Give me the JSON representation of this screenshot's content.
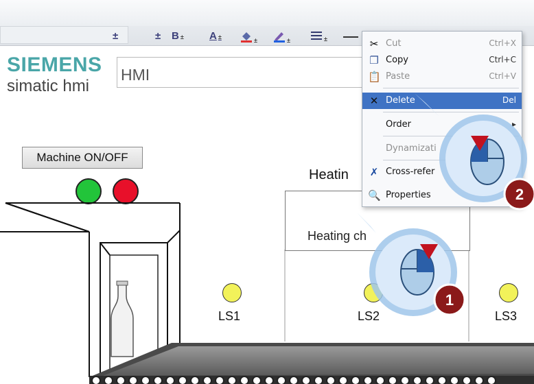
{
  "toolbar": {
    "bold": "B",
    "font_color": "A",
    "drop": "±"
  },
  "logo": {
    "brand": "SIEMENS",
    "product": "simatic hmi"
  },
  "screen_title": "HMI",
  "machine_button": "Machine ON/OFF",
  "heating": {
    "heading": "Heatin",
    "label": "Heating ch"
  },
  "sensors": [
    "LS1",
    "LS2",
    "LS3"
  ],
  "context_menu": {
    "items": [
      {
        "label": "Cut",
        "shortcut": "Ctrl+X",
        "icon": "scissors-icon",
        "enabled": false
      },
      {
        "label": "Copy",
        "shortcut": "Ctrl+C",
        "icon": "copy-icon",
        "enabled": true
      },
      {
        "label": "Paste",
        "shortcut": "Ctrl+V",
        "icon": "paste-icon",
        "enabled": false
      },
      {
        "label": "Delete",
        "shortcut": "Del",
        "icon": "delete-x-icon",
        "enabled": true,
        "selected": true
      },
      {
        "label": "Order",
        "shortcut": "",
        "icon": "",
        "enabled": true,
        "submenu": true
      },
      {
        "label": "Dynamizati",
        "shortcut": "",
        "icon": "",
        "enabled": false
      },
      {
        "label": "Cross-refer",
        "shortcut": "",
        "icon": "cross-reference-icon",
        "enabled": true
      },
      {
        "label": "Properties",
        "shortcut": "",
        "icon": "properties-icon",
        "enabled": true
      }
    ]
  },
  "callouts": [
    "1",
    "2"
  ],
  "colors": {
    "lamp_on": "#22c43a",
    "lamp_off": "#e8102a",
    "sensor": "#f2f25a",
    "menu_highlight": "#3f73c4",
    "callout_badge": "#8b1a1a",
    "logo": "#4aa6a8"
  }
}
